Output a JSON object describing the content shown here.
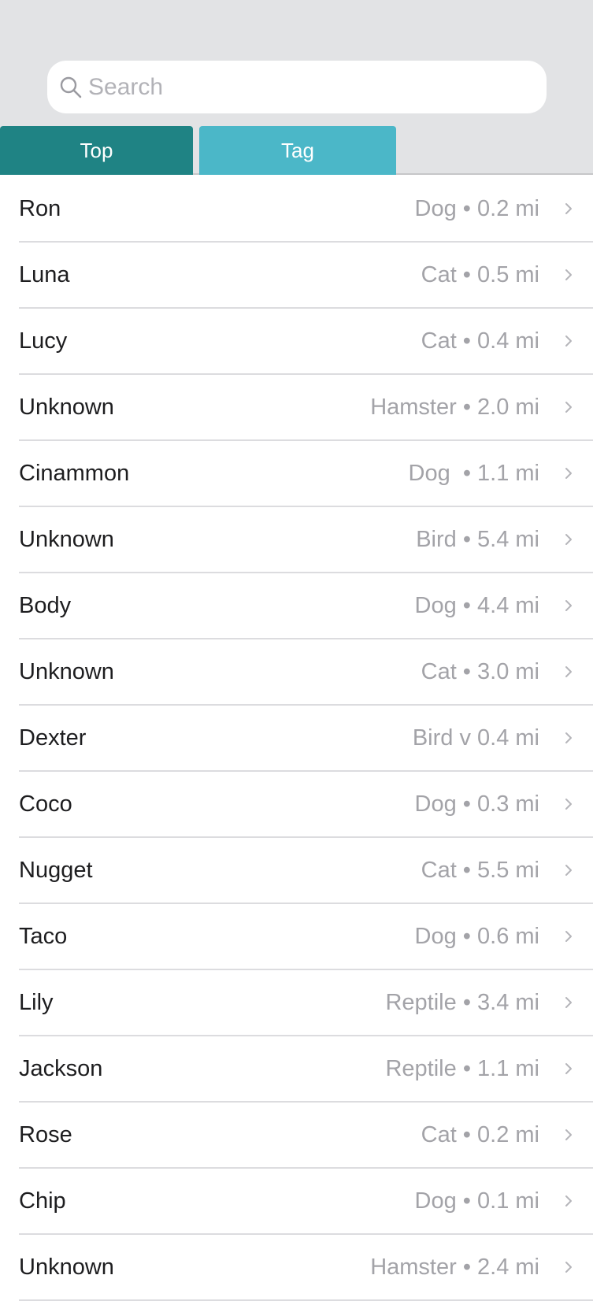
{
  "search": {
    "placeholder": "Search",
    "icon": "magnifier-icon"
  },
  "tabs": [
    {
      "label": "Top",
      "color": "#1f8384",
      "selected": true
    },
    {
      "label": "Tag",
      "color": "#4bb7c8",
      "selected": false
    }
  ],
  "pets": [
    {
      "name": "Ron",
      "detail": "Dog • 0.2 mi"
    },
    {
      "name": "Luna",
      "detail": "Cat • 0.5 mi"
    },
    {
      "name": "Lucy",
      "detail": "Cat • 0.4 mi"
    },
    {
      "name": "Unknown",
      "detail": "Hamster • 2.0 mi"
    },
    {
      "name": "Cinammon",
      "detail": "Dog  • 1.1 mi"
    },
    {
      "name": "Unknown",
      "detail": "Bird • 5.4 mi"
    },
    {
      "name": "Body",
      "detail": "Dog • 4.4 mi"
    },
    {
      "name": "Unknown",
      "detail": "Cat • 3.0 mi"
    },
    {
      "name": "Dexter",
      "detail": "Bird v 0.4 mi"
    },
    {
      "name": "Coco",
      "detail": "Dog • 0.3 mi"
    },
    {
      "name": "Nugget",
      "detail": "Cat • 5.5 mi"
    },
    {
      "name": "Taco",
      "detail": "Dog • 0.6 mi"
    },
    {
      "name": "Lily",
      "detail": "Reptile • 3.4 mi"
    },
    {
      "name": "Jackson",
      "detail": "Reptile • 1.1 mi"
    },
    {
      "name": "Rose",
      "detail": "Cat • 0.2 mi"
    },
    {
      "name": "Chip",
      "detail": "Dog • 0.1 mi"
    },
    {
      "name": "Unknown",
      "detail": "Hamster • 2.4 mi"
    }
  ],
  "row_icon": "chevron-right-icon"
}
